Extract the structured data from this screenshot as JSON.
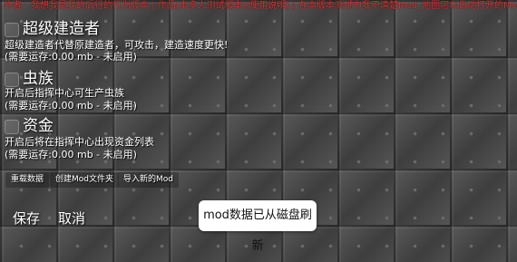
{
  "banner": "作者：我想我是我的后行的行为版本 | 作品(本多人测试版本)(使用说明) | 在本版本测试中我不清楚Mod_地图可以自动打开的Mod",
  "mods": [
    {
      "title": "超级建造者",
      "description": "超级建造者代替原建造者，可攻击，建造速度更快!",
      "status": "(需要运存:0.00 mb - 未启用)"
    },
    {
      "title": "虫族",
      "description": "开启后指挥中心可生产虫族",
      "status": "(需要运存:0.00 mb - 未启用)"
    },
    {
      "title": "资金",
      "description": "开启后将在指挥中心出现资金列表",
      "status": "(需要运存:0.00 mb - 未启用)"
    }
  ],
  "toolbar": {
    "reload_label": "重载数据",
    "create_folder_label": "创建Mod文件夹",
    "import_label": "导入新的Mod"
  },
  "actions": {
    "save_label": "保存",
    "cancel_label": "取消"
  },
  "toast": "mod数据已从磁盘刷新"
}
